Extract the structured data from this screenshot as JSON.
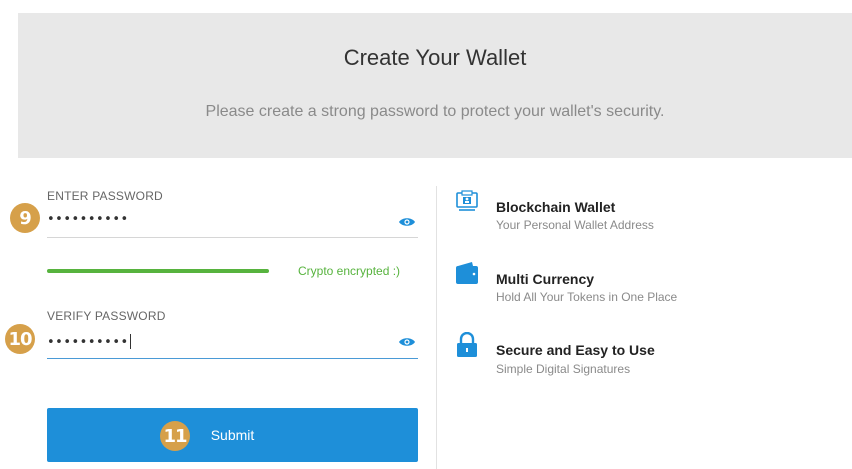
{
  "header": {
    "title": "Create Your Wallet",
    "subtitle": "Please create a strong password to protect your wallet's security."
  },
  "form": {
    "password": {
      "label": "ENTER PASSWORD",
      "value": "••••••••••",
      "badge": "9",
      "toggle_icon": "eye-icon"
    },
    "strength": {
      "text": "Crypto encrypted :)",
      "level": 1.0,
      "color": "#57b33e"
    },
    "verify": {
      "label": "VERIFY PASSWORD",
      "value": "••••••••••",
      "badge": "10",
      "toggle_icon": "eye-icon"
    },
    "submit": {
      "label": "Submit",
      "badge": "11",
      "color": "#1e8fd9"
    }
  },
  "features": [
    {
      "icon": "blockchain-icon",
      "title": "Blockchain Wallet",
      "subtitle": "Your Personal Wallet Address"
    },
    {
      "icon": "wallet-icon",
      "title": "Multi Currency",
      "subtitle": "Hold All Your Tokens in One Place"
    },
    {
      "icon": "lock-icon",
      "title": "Secure and Easy to Use",
      "subtitle": "Simple Digital Signatures"
    }
  ],
  "colors": {
    "accent": "#1e8fd9",
    "success": "#57b33e",
    "badge": "#d6a04a",
    "header_bg": "#e8e8e8"
  }
}
